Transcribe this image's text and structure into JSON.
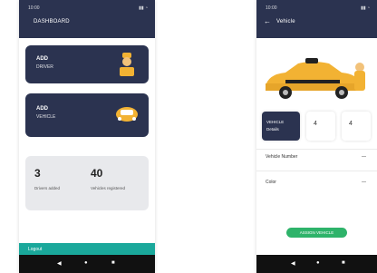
{
  "left_phone": {
    "status_time": "10:00",
    "status_icons": "▮▮ ◔",
    "appbar_title": "DASHBOARD",
    "cards": [
      {
        "line1": "ADD",
        "line2": "DRIVER",
        "icon": "driver-icon"
      },
      {
        "line1": "ADD",
        "line2": "VEHICLE",
        "icon": "car-icon"
      }
    ],
    "stats": [
      {
        "value": "3",
        "label": "Drivers added"
      },
      {
        "value": "40",
        "label": "Vehicles registered"
      }
    ],
    "bottom_bar_label": "Logout",
    "nav": [
      "◀",
      "●",
      "■"
    ]
  },
  "right_phone": {
    "status_time": "10:00",
    "status_icons": "▮▮ ◔",
    "appbar_title": "Vehicle",
    "tiles": [
      {
        "line1": "VEHICLE",
        "line2": "Details",
        "active": true
      },
      {
        "line1": "4",
        "line2": "",
        "active": false
      },
      {
        "line1": "4",
        "line2": "",
        "active": false
      }
    ],
    "rows": [
      {
        "label": "Vehicle Number",
        "value": "—"
      },
      {
        "label": "Color",
        "value": "—"
      }
    ],
    "button_label": "ASSIGN VEHICLE",
    "nav": [
      "◀",
      "●",
      "■"
    ]
  },
  "colors": {
    "navy": "#2b3350",
    "teal": "#1aa89b",
    "green": "#2eb36a",
    "taxi": "#f2b233"
  }
}
